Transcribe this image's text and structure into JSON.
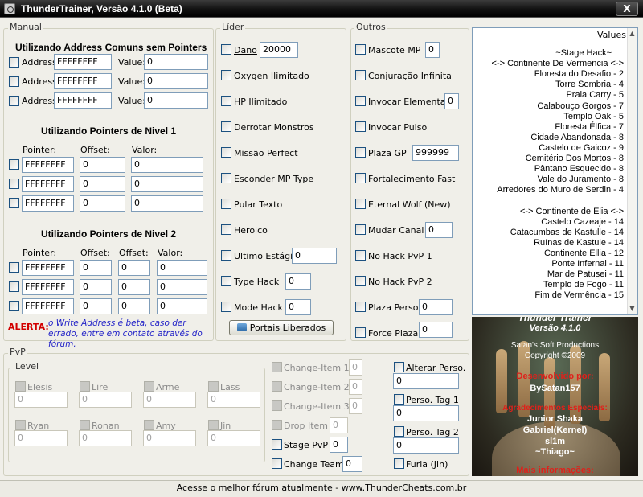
{
  "window": {
    "title": "ThunderTrainer, Versão 4.1.0 (Beta)",
    "close": "X"
  },
  "manual": {
    "legend": "Manual",
    "sec1_title": "Utilizando Address Comuns sem Pointers",
    "sec1_rows": [
      {
        "label": "Address",
        "address": "FFFFFFFF",
        "value_label": "Value:",
        "value": "0"
      },
      {
        "label": "Address",
        "address": "FFFFFFFF",
        "value_label": "Value:",
        "value": "0"
      },
      {
        "label": "Address",
        "address": "FFFFFFFF",
        "value_label": "Value:",
        "value": "0"
      }
    ],
    "sec2_title": "Utilizando Pointers de Nivel 1",
    "sec2_headers": [
      "Pointer:",
      "Offset:",
      "Valor:"
    ],
    "sec2_rows": [
      {
        "pointer": "FFFFFFFF",
        "offset": "0",
        "valor": "0"
      },
      {
        "pointer": "FFFFFFFF",
        "offset": "0",
        "valor": "0"
      },
      {
        "pointer": "FFFFFFFF",
        "offset": "0",
        "valor": "0"
      }
    ],
    "sec3_title": "Utilizando Pointers de Nivel 2",
    "sec3_headers": [
      "Pointer:",
      "Offset:",
      "Offset:",
      "Valor:"
    ],
    "sec3_rows": [
      {
        "pointer": "FFFFFFFF",
        "offset1": "0",
        "offset2": "0",
        "valor": "0"
      },
      {
        "pointer": "FFFFFFFF",
        "offset1": "0",
        "offset2": "0",
        "valor": "0"
      },
      {
        "pointer": "FFFFFFFF",
        "offset1": "0",
        "offset2": "0",
        "valor": "0"
      }
    ],
    "alert_label": "ALERTA:",
    "alert_text": "o Write Address é beta, caso der errado, entre em contato através do fórum."
  },
  "lider": {
    "legend": "Líder",
    "dano_label": "Dano",
    "dano_value": "20000",
    "items": [
      "Oxygen Ilimitado",
      "HP Ilimitado",
      "Derrotar Monstros",
      "Missão Perfect",
      "Esconder MP Type",
      "Pular Texto",
      "Heroico"
    ],
    "ultimo_label": "Ultimo Estágio",
    "ultimo_value": "0",
    "type_hack_label": "Type Hack",
    "type_hack_value": "0",
    "mode_hack_label": "Mode Hack",
    "mode_hack_value": "0",
    "portais_button": "Portais Liberados"
  },
  "outros": {
    "legend": "Outros",
    "mascote_label": "Mascote MP",
    "mascote_value": "0",
    "conjuracao": "Conjuração Infinita",
    "invocar_elemental": "Invocar Elemental",
    "invocar_elemental_value": "0",
    "invocar_pulso": "Invocar Pulso",
    "plaza_gp_label": "Plaza GP",
    "plaza_gp_value": "999999",
    "fortalecimento": "Fortalecimento Fast",
    "eternal_wolf": "Eternal Wolf (New)",
    "mudar_canal": "Mudar Canal",
    "mudar_canal_value": "0",
    "no_hack_pvp1": "No Hack PvP 1",
    "no_hack_pvp2": "No Hack PvP 2",
    "plaza_perso_label": "Plaza Perso.",
    "plaza_perso_value": "0",
    "force_plaza_label": "Force Plaza",
    "force_plaza_value": "0"
  },
  "values_list": {
    "header": "Values",
    "items": [
      "~Stage Hack~",
      "<-> Continente De Vermencia <->",
      "Floresta do Desafio - 2",
      "Torre Sombria - 4",
      "Praia Carry - 5",
      "Calabouço Gorgos - 7",
      "Templo Oak - 5",
      "Floresta Élfica - 7",
      "Cidade Abandonada - 8",
      "Castelo de Gaicoz - 9",
      "Cemitério Dos Mortos - 8",
      "Pântano Esquecido - 8",
      "Vale do Juramento - 8",
      "Arredores do Muro de Serdin - 4",
      "",
      "<-> Continente de Elia <->",
      "Castelo Cazeaje - 14",
      "Catacumbas de Kastulle - 14",
      "Ruínas de Kastule - 14",
      "Continente Ellia - 12",
      "Ponte Infernal - 11",
      "Mar de Patusei - 11",
      "Templo de Fogo - 11",
      "Fim de Vermência - 15"
    ]
  },
  "banner": {
    "lines": [
      "Thunder Trainer",
      "Versão 4.1.0",
      "Satan's Soft Productions",
      "Copyright ©2009",
      "Desenvolvido por:",
      "BySatan157",
      "Agradecimentos Especiais:",
      "Junior Shaka",
      "Gabriel(Kernel)",
      "sl1m",
      "~Thiago~",
      "Mais informações:"
    ]
  },
  "pvp": {
    "legend": "PvP",
    "level_legend": "Level",
    "classes": [
      {
        "name": "Elesis",
        "value": "0"
      },
      {
        "name": "Lire",
        "value": "0"
      },
      {
        "name": "Arme",
        "value": "0"
      },
      {
        "name": "Lass",
        "value": "0"
      },
      {
        "name": "Ryan",
        "value": "0"
      },
      {
        "name": "Ronan",
        "value": "0"
      },
      {
        "name": "Amy",
        "value": "0"
      },
      {
        "name": "Jin",
        "value": "0"
      }
    ],
    "change_items": [
      {
        "label": "Change-Item 1",
        "value": "0"
      },
      {
        "label": "Change-Item 2",
        "value": "0"
      },
      {
        "label": "Change-Item 3",
        "value": "0"
      }
    ],
    "drop_item_label": "Drop Item",
    "drop_item_value": "0",
    "stage_pvp_label": "Stage PvP",
    "stage_pvp_value": "0",
    "change_team_label": "Change Team",
    "change_team_value": "0",
    "alterar_perso_label": "Alterar Perso.",
    "alterar_perso_value": "0",
    "perso_tag1_label": "Perso. Tag 1",
    "perso_tag1_value": "0",
    "perso_tag2_label": "Perso. Tag 2",
    "perso_tag2_value": "0",
    "furia_label": "Furia (Jin)"
  },
  "status": {
    "text": "Acesse o melhor fórum atualmente - www.ThunderCheats.com.br"
  }
}
